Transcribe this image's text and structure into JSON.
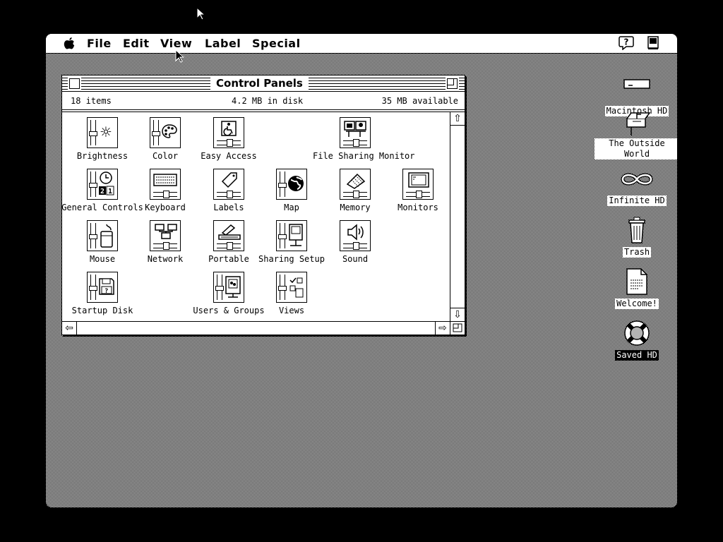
{
  "menubar": {
    "items": [
      "File",
      "Edit",
      "View",
      "Label",
      "Special"
    ],
    "apple_icon": "apple-icon",
    "help_icon": "help-balloon-icon",
    "app_icon": "finder-app-icon"
  },
  "window": {
    "title": "Control Panels",
    "item_count": "18 items",
    "disk_used": "4.2 MB in disk",
    "available": "35 MB available",
    "items": [
      {
        "label": "Brightness",
        "icon": "brightness-icon"
      },
      {
        "label": "Color",
        "icon": "color-palette-icon"
      },
      {
        "label": "Easy Access",
        "icon": "easy-access-icon"
      },
      {
        "label": "File Sharing Monitor",
        "icon": "file-sharing-monitor-icon"
      },
      {
        "label": "General Controls",
        "icon": "general-controls-icon"
      },
      {
        "label": "Keyboard",
        "icon": "keyboard-icon"
      },
      {
        "label": "Labels",
        "icon": "labels-tag-icon"
      },
      {
        "label": "Map",
        "icon": "globe-icon"
      },
      {
        "label": "Memory",
        "icon": "memory-chip-icon"
      },
      {
        "label": "Monitors",
        "icon": "monitor-icon"
      },
      {
        "label": "Mouse",
        "icon": "mouse-icon"
      },
      {
        "label": "Network",
        "icon": "network-icon"
      },
      {
        "label": "Portable",
        "icon": "portable-icon"
      },
      {
        "label": "Sharing Setup",
        "icon": "sharing-setup-icon"
      },
      {
        "label": "Sound",
        "icon": "speaker-icon"
      },
      {
        "label": "Startup Disk",
        "icon": "startup-disk-icon"
      },
      {
        "label": "Users & Groups",
        "icon": "users-groups-icon"
      },
      {
        "label": "Views",
        "icon": "views-icon"
      }
    ]
  },
  "desktop": {
    "icons": [
      {
        "label": "Macintosh HD",
        "icon": "hard-disk-icon",
        "selected": false
      },
      {
        "label": "The Outside World",
        "icon": "mailbox-icon",
        "selected": false
      },
      {
        "label": "Infinite HD",
        "icon": "infinity-disk-icon",
        "selected": false
      },
      {
        "label": "Trash",
        "icon": "trash-icon",
        "selected": false
      },
      {
        "label": "Welcome!",
        "icon": "document-icon",
        "selected": false
      },
      {
        "label": "Saved HD",
        "icon": "life-preserver-icon",
        "selected": true
      }
    ]
  }
}
